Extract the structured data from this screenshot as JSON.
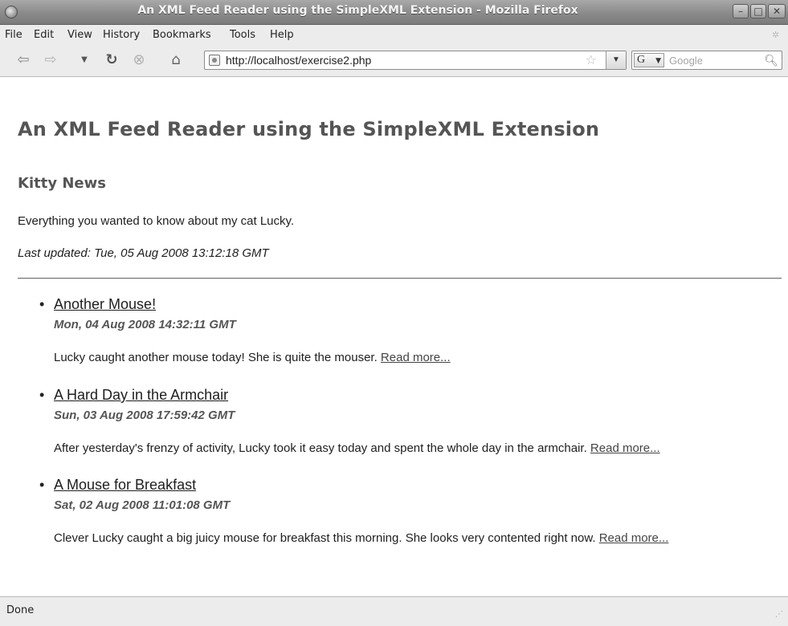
{
  "window": {
    "title": "An XML Feed Reader using the SimpleXML Extension - Mozilla Firefox",
    "controls": {
      "minimize": "–",
      "maximize": "□",
      "close": "✕"
    }
  },
  "menubar": {
    "items": [
      {
        "label": "File",
        "key": "F"
      },
      {
        "label": "Edit",
        "key": ""
      },
      {
        "label": "View",
        "key": "V"
      },
      {
        "label": "History",
        "key": ""
      },
      {
        "label": "Bookmarks",
        "key": "B"
      },
      {
        "label": "Tools",
        "key": "T"
      },
      {
        "label": "Help",
        "key": "H"
      }
    ]
  },
  "toolbar": {
    "icons": [
      "back-icon",
      "forward-icon",
      "dropdown-icon",
      "reload-icon",
      "stop-icon",
      "home-icon"
    ],
    "url": "http://localhost/exercise2.php",
    "search_engine": "G",
    "search_placeholder": "Google"
  },
  "page": {
    "heading": "An XML Feed Reader using the SimpleXML Extension",
    "channel_title": "Kitty News",
    "channel_description": "Everything you wanted to know about my cat Lucky.",
    "last_updated": "Last updated: Tue, 05 Aug 2008 13:12:18 GMT",
    "items": [
      {
        "title": "Another Mouse!",
        "date": "Mon, 04 Aug 2008 14:32:11 GMT",
        "text": "Lucky caught another mouse today! She is quite the mouser.",
        "read_more": "Read more..."
      },
      {
        "title": "A Hard Day in the Armchair",
        "date": "Sun, 03 Aug 2008 17:59:42 GMT",
        "text": "After yesterday's frenzy of activity, Lucky took it easy today and spent the whole day in the armchair.",
        "read_more": "Read more..."
      },
      {
        "title": "A Mouse for Breakfast",
        "date": "Sat, 02 Aug 2008 11:01:08 GMT",
        "text": "Clever Lucky caught a big juicy mouse for breakfast this morning. She looks very contented right now.",
        "read_more": "Read more..."
      }
    ]
  },
  "status": {
    "text": "Done"
  }
}
